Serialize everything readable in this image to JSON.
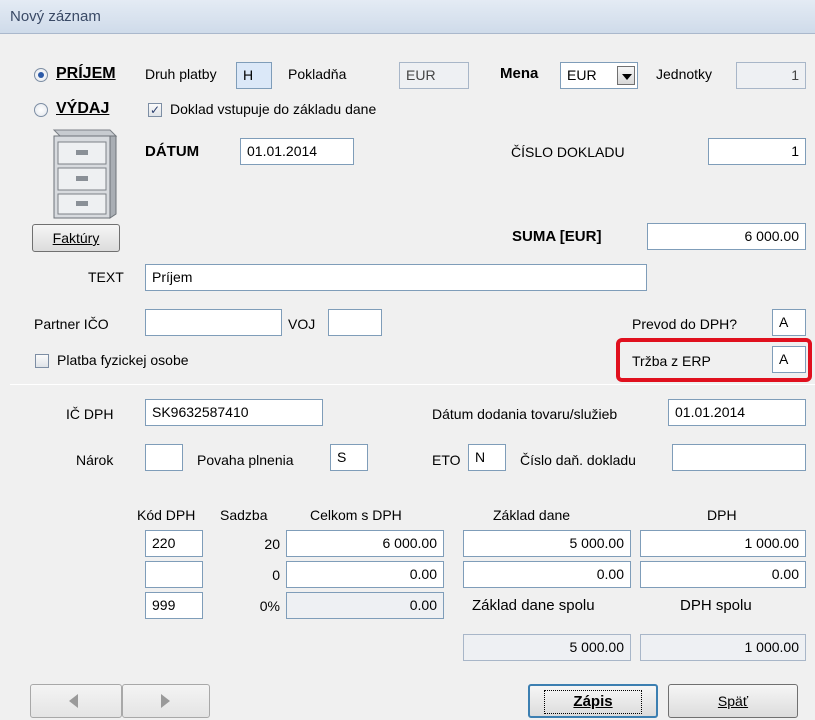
{
  "window": {
    "title": "Nový záznam"
  },
  "header": {
    "prijem_label": "PRÍJEM",
    "vydaj_label": "VÝDAJ",
    "druh_platby_label": "Druh platby",
    "druh_platby_value": "H",
    "pokladna_label": "Pokladňa",
    "pokladna_value": "EUR",
    "mena_label": "Mena",
    "mena_value": "EUR",
    "jednotky_label": "Jednotky",
    "jednotky_value": "1",
    "doklad_checkbox_label": "Doklad vstupuje do základu dane",
    "datum_label": "DÁTUM",
    "datum_value": "01.01.2014",
    "cislo_dokladu_label": "ČÍSLO DOKLADU",
    "cislo_dokladu_value": "1",
    "faktury_button": "Faktúry",
    "suma_label": "SUMA [EUR]",
    "suma_value": "6 000.00",
    "text_label": "TEXT",
    "text_value": "Príjem",
    "partner_ico_label": "Partner IČO",
    "partner_ico_value": "",
    "voj_label": "VOJ",
    "voj_value": "",
    "prevod_label": "Prevod do DPH?",
    "prevod_value": "A",
    "platba_label": "Platba fyzickej osobe",
    "trzba_label": "Tržba z ERP",
    "trzba_value": "A"
  },
  "dph": {
    "ic_dph_label": "IČ DPH",
    "ic_dph_value": "SK9632587410",
    "datum_dodania_label": "Dátum dodania tovaru/služieb",
    "datum_dodania_value": "01.01.2014",
    "narok_label": "Nárok",
    "narok_value": "",
    "povaha_label": "Povaha plnenia",
    "povaha_value": "S",
    "eto_label": "ETO",
    "eto_value": "N",
    "cislo_dan_label": "Číslo daň. dokladu",
    "cislo_dan_value": ""
  },
  "table": {
    "headers": {
      "kod": "Kód DPH",
      "sadzba": "Sadzba",
      "celkom": "Celkom s DPH",
      "zaklad": "Základ dane",
      "dph": "DPH"
    },
    "rows": [
      {
        "kod": "220",
        "sadzba": "20",
        "celkom": "6 000.00",
        "zaklad": "5 000.00",
        "dph": "1 000.00"
      },
      {
        "kod": "",
        "sadzba": "0",
        "celkom": "0.00",
        "zaklad": "0.00",
        "dph": "0.00"
      },
      {
        "kod": "999",
        "sadzba": "0%",
        "celkom": "0.00"
      }
    ],
    "zaklad_spolu_label": "Základ dane spolu",
    "dph_spolu_label": "DPH spolu",
    "zaklad_spolu_value": "5 000.00",
    "dph_spolu_value": "1 000.00"
  },
  "footer": {
    "zapis_button": "Zápis",
    "spat_button": "Späť"
  },
  "icons": {
    "cabinet": "file-cabinet-icon",
    "prev": "arrow-left-icon",
    "next": "arrow-right-icon"
  },
  "colors": {
    "highlight": "#e0101e",
    "title_text": "#3a4a66"
  }
}
